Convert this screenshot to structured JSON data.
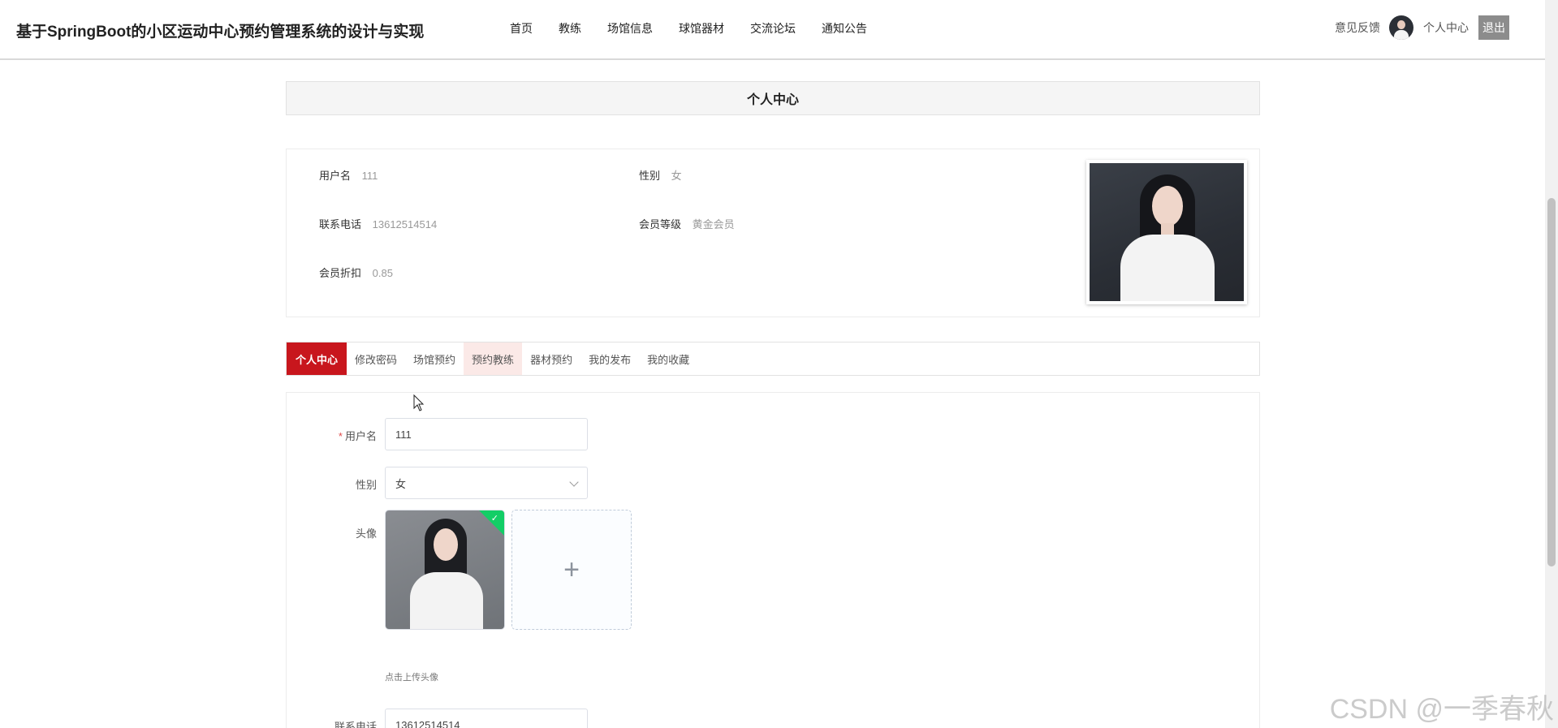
{
  "header": {
    "site_title": "基于SpringBoot的小区运动中心预约管理系统的设计与实现",
    "nav": [
      "首页",
      "教练",
      "场馆信息",
      "球馆器材",
      "交流论坛",
      "通知公告"
    ],
    "feedback": "意见反馈",
    "personal_center": "个人中心",
    "logout": "退出"
  },
  "page_title": "个人中心",
  "profile": {
    "username_label": "用户名",
    "username_value": "111",
    "gender_label": "性别",
    "gender_value": "女",
    "phone_label": "联系电话",
    "phone_value": "13612514514",
    "level_label": "会员等级",
    "level_value": "黄金会员",
    "discount_label": "会员折扣",
    "discount_value": "0.85"
  },
  "tabs": [
    {
      "label": "个人中心",
      "state": "active"
    },
    {
      "label": "修改密码",
      "state": "normal"
    },
    {
      "label": "场馆预约",
      "state": "normal"
    },
    {
      "label": "预约教练",
      "state": "hover"
    },
    {
      "label": "器材预约",
      "state": "normal"
    },
    {
      "label": "我的发布",
      "state": "normal"
    },
    {
      "label": "我的收藏",
      "state": "normal"
    }
  ],
  "form": {
    "required_mark": "*",
    "username_label": "用户名",
    "username_value": "111",
    "gender_label": "性别",
    "gender_value": "女",
    "avatar_label": "头像",
    "upload_tip": "点击上传头像",
    "phone_label": "联系电话",
    "phone_value": "13612514514"
  },
  "watermark": "CSDN @一季春秋",
  "colors": {
    "accent": "#c8161d",
    "tab_hover": "#fbe9e7",
    "upload_success": "#13ce66"
  }
}
